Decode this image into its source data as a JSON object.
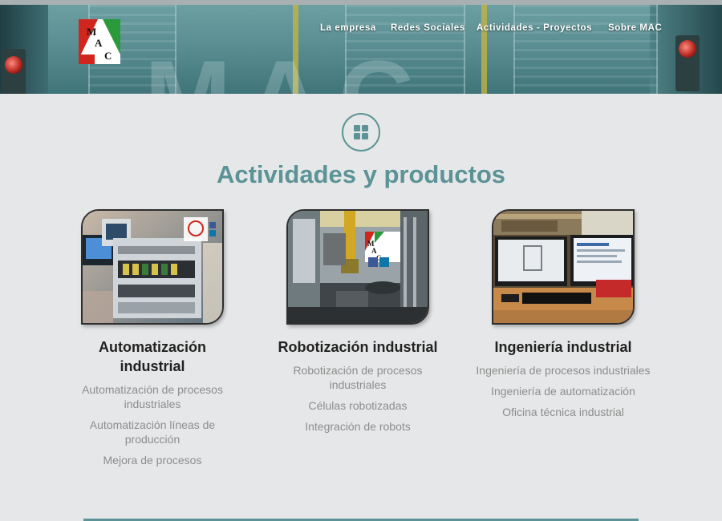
{
  "header": {
    "watermark": "MAC",
    "logo_letters": [
      "M",
      "A",
      "C"
    ],
    "nav": [
      {
        "label": "La empresa"
      },
      {
        "label": "Redes Sociales"
      },
      {
        "label": "Actividades - Proyectos"
      },
      {
        "label": "Sobre MAC"
      }
    ]
  },
  "section": {
    "icon": "grid-icon",
    "title": "Actividades y productos"
  },
  "cards": [
    {
      "title": "Automatización industrial",
      "image_icon": "control-panel-photo",
      "items": [
        "Automatización de procesos industriales",
        "Automatización líneas de producción",
        "Mejora de procesos"
      ]
    },
    {
      "title": "Robotización industrial",
      "image_icon": "robot-cell-photo",
      "items": [
        "Robotización de procesos industriales",
        "Células robotizadas",
        "Integración de robots"
      ]
    },
    {
      "title": "Ingeniería industrial",
      "image_icon": "engineering-workstation-photo",
      "items": [
        "Ingeniería de procesos industriales",
        "Ingeniería de automatización",
        "Oficina técnica industrial"
      ]
    }
  ],
  "colors": {
    "accent": "#5b9396",
    "background": "#e6e7e8",
    "heading": "#222222",
    "muted_text": "#8d8d8d"
  }
}
